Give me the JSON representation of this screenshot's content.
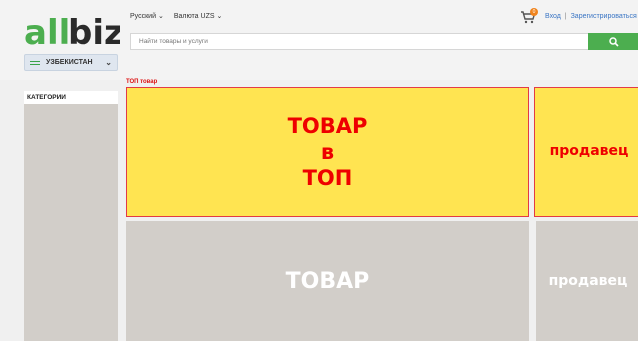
{
  "brand": {
    "logo_text": "allbiz",
    "colors": {
      "green": "#4cae4f",
      "dark": "#2a2a2a",
      "red": "#e00000",
      "yellow": "#ffe451"
    }
  },
  "header": {
    "language": "Русский",
    "currency": "Валюта UZS",
    "search_placeholder": "Найти товары и услуги",
    "search_icon": "search-icon",
    "cart_count": "0",
    "login": "Вход",
    "separator": "|",
    "register": "Зарегистрироваться"
  },
  "country_selector": {
    "label": "УЗБЕКИСТАН"
  },
  "sidebar": {
    "title": "КАТЕГОРИИ"
  },
  "main": {
    "top_label": "ТОП товар",
    "promo_main_lines": [
      "ТОВАР",
      "в",
      "ТОП"
    ],
    "promo_side": "продавец",
    "gray_main": "ТОВАР",
    "gray_side": "продавец"
  }
}
